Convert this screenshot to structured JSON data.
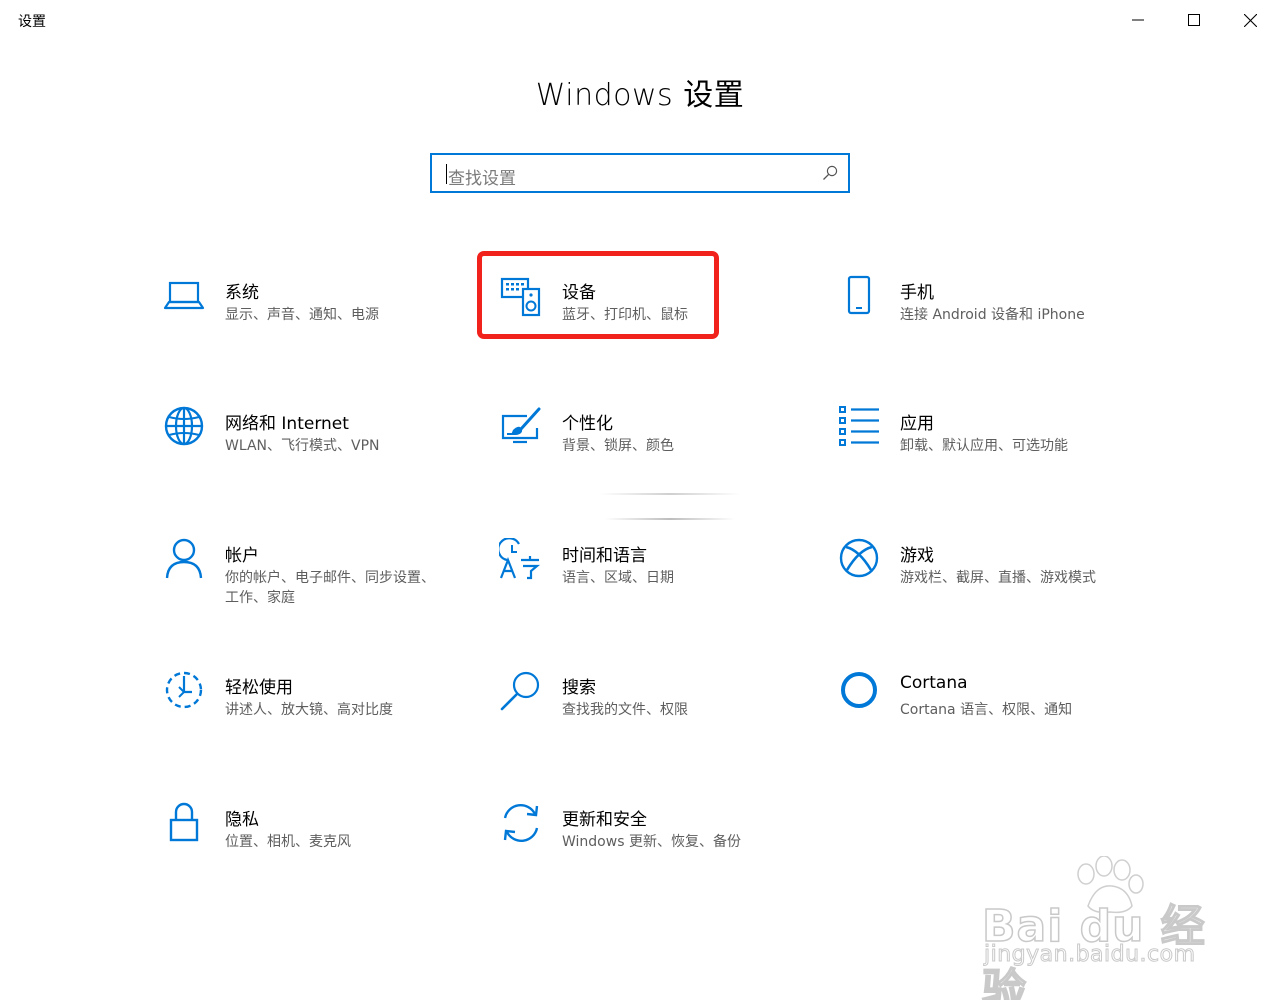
{
  "window": {
    "title": "设置",
    "minimize_label": "minimize",
    "maximize_label": "maximize",
    "close_label": "close"
  },
  "heading": "Windows 设置",
  "search": {
    "placeholder": "查找设置",
    "icon": "search-icon"
  },
  "categories": [
    {
      "name": "系统",
      "desc": "显示、声音、通知、电源",
      "icon": "laptop-icon"
    },
    {
      "name": "设备",
      "desc": "蓝牙、打印机、鼠标",
      "icon": "devices-icon",
      "highlighted": true
    },
    {
      "name": "手机",
      "desc": "连接 Android 设备和 iPhone",
      "icon": "phone-icon"
    },
    {
      "name": "网络和 Internet",
      "desc": "WLAN、飞行模式、VPN",
      "icon": "globe-icon"
    },
    {
      "name": "个性化",
      "desc": "背景、锁屏、颜色",
      "icon": "personalization-icon"
    },
    {
      "name": "应用",
      "desc": "卸载、默认应用、可选功能",
      "icon": "apps-list-icon"
    },
    {
      "name": "帐户",
      "desc": "你的帐户、电子邮件、同步设置、工作、家庭",
      "icon": "person-icon"
    },
    {
      "name": "时间和语言",
      "desc": "语言、区域、日期",
      "icon": "time-language-icon"
    },
    {
      "name": "游戏",
      "desc": "游戏栏、截屏、直播、游戏模式",
      "icon": "xbox-icon"
    },
    {
      "name": "轻松使用",
      "desc": "讲述人、放大镜、高对比度",
      "icon": "ease-of-access-icon"
    },
    {
      "name": "搜索",
      "desc": "查找我的文件、权限",
      "icon": "magnifier-icon"
    },
    {
      "name": "Cortana",
      "desc": "Cortana 语言、权限、通知",
      "icon": "cortana-ring-icon"
    },
    {
      "name": "隐私",
      "desc": "位置、相机、麦克风",
      "icon": "lock-icon"
    },
    {
      "name": "更新和安全",
      "desc": "Windows 更新、恢复、备份",
      "icon": "sync-icon"
    }
  ],
  "colors": {
    "accent": "#0078d7",
    "highlight": "#f1221c",
    "description": "#5e5e5e"
  },
  "watermark": {
    "logo_text": "Bai du 经验",
    "url_text": "jingyan.baidu.com"
  }
}
